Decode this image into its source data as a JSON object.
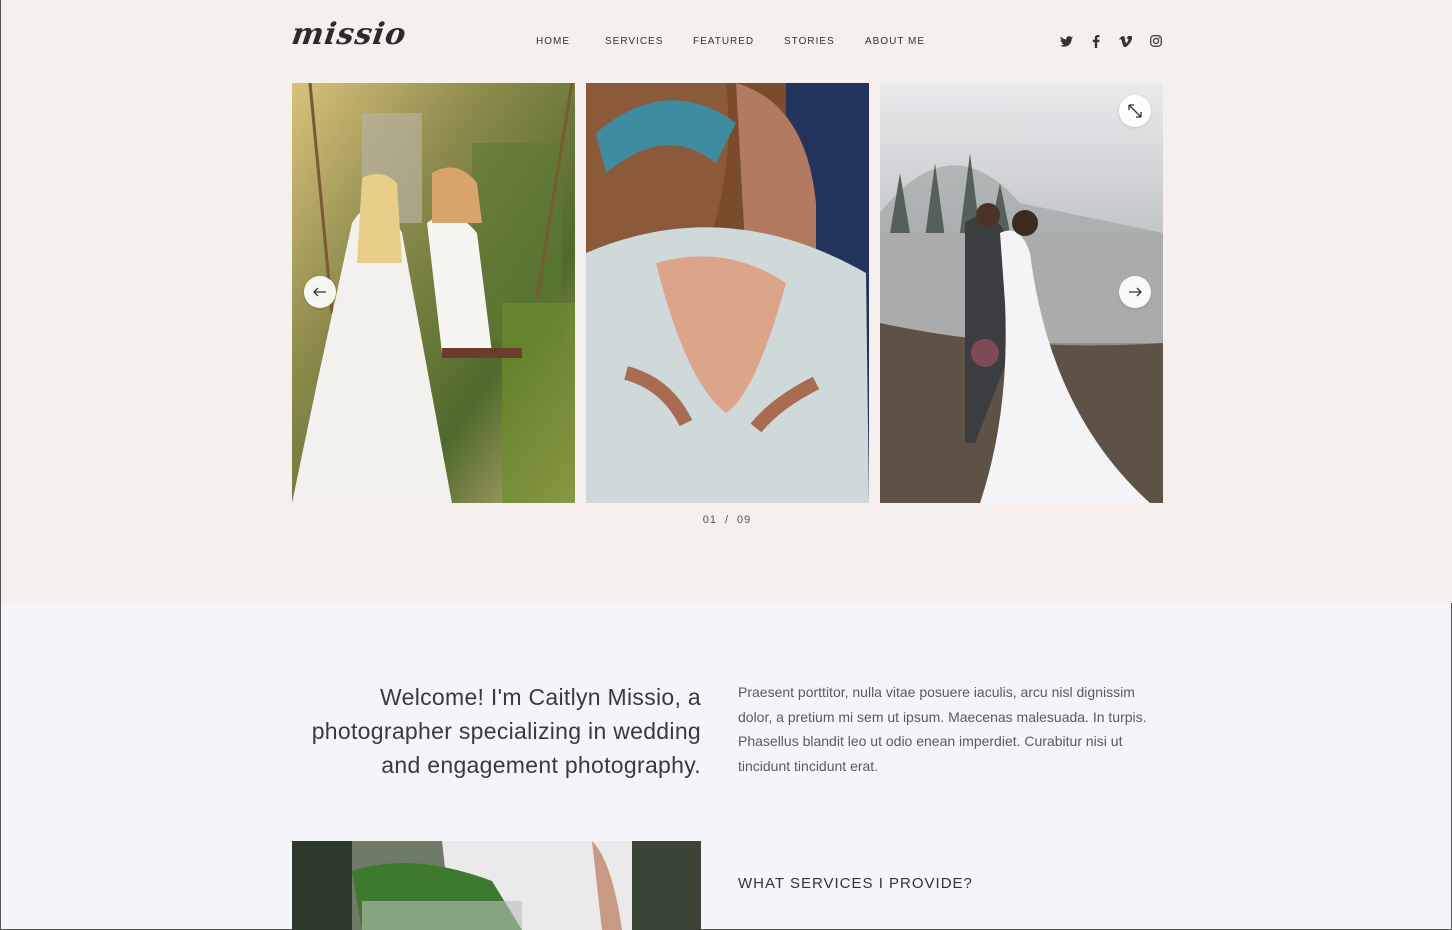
{
  "brand": {
    "logo_text": "missio"
  },
  "nav": {
    "items": [
      {
        "label": "HOME"
      },
      {
        "label": "SERVICES"
      },
      {
        "label": "FEATURED"
      },
      {
        "label": "STORIES"
      },
      {
        "label": "ABOUT ME"
      }
    ]
  },
  "social": {
    "icons": [
      "twitter-icon",
      "facebook-icon",
      "vimeo-icon",
      "instagram-icon"
    ]
  },
  "slider": {
    "current": "01",
    "separator": "/",
    "total": "09",
    "controls": [
      "arrow-left-icon",
      "arrow-right-icon",
      "expand-icon"
    ]
  },
  "about": {
    "headline": "Welcome! I'm Caitlyn Missio, a photographer specializing in wedding and engagement photography.",
    "body": "Praesent porttitor, nulla vitae posuere iaculis, arcu nisl dignissim dolor, a pretium mi sem ut ipsum. Maecenas malesuada. In turpis. Phasellus blandit leo ut odio enean imperdiet. Curabitur nisi ut tincidunt tincidunt erat."
  },
  "services": {
    "heading": "WHAT SERVICES I PROVIDE?"
  },
  "colors": {
    "hero_bg": "#f5efee",
    "page_bg": "#f4f5f9",
    "text": "#3a3a3a"
  }
}
